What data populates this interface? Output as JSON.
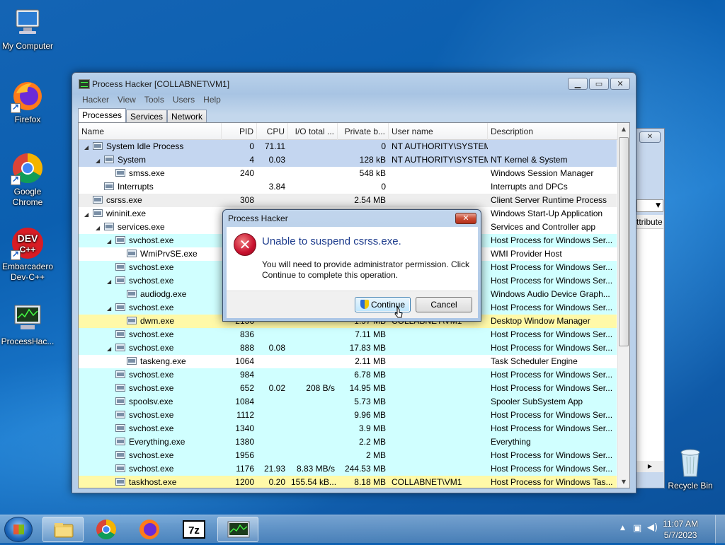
{
  "desktop": {
    "icons": [
      {
        "label": "My Computer"
      },
      {
        "label": "Firefox"
      },
      {
        "label": "Google Chrome"
      },
      {
        "label": "Embarcadero Dev-C++"
      },
      {
        "label": "ProcessHac..."
      },
      {
        "label": "Recycle Bin"
      }
    ]
  },
  "window": {
    "title": "Process Hacker [COLLABNET\\VM1]",
    "menu": [
      "Hacker",
      "View",
      "Tools",
      "Users",
      "Help"
    ],
    "tabs": [
      "Processes",
      "Services",
      "Network"
    ],
    "active_tab": "Processes",
    "columns": [
      "Name",
      "PID",
      "CPU",
      "I/O total ...",
      "Private b...",
      "User name",
      "Description"
    ],
    "rows": [
      {
        "name": "System Idle Process",
        "pid": "0",
        "cpu": "71.11",
        "io": "",
        "priv": "0",
        "user": "NT AUTHORITY\\SYSTEM",
        "desc": "",
        "style": "sys",
        "depth": 0,
        "expand": "◢"
      },
      {
        "name": "System",
        "pid": "4",
        "cpu": "0.03",
        "io": "",
        "priv": "128 kB",
        "user": "NT AUTHORITY\\SYSTEM",
        "desc": "NT Kernel & System",
        "style": "sys",
        "depth": 1,
        "expand": "◢"
      },
      {
        "name": "smss.exe",
        "pid": "240",
        "cpu": "",
        "io": "",
        "priv": "548 kB",
        "user": "",
        "desc": "Windows Session Manager",
        "style": "plain",
        "depth": 2,
        "expand": ""
      },
      {
        "name": "Interrupts",
        "pid": "",
        "cpu": "3.84",
        "io": "",
        "priv": "0",
        "user": "",
        "desc": "Interrupts and DPCs",
        "style": "plain",
        "depth": 1,
        "expand": ""
      },
      {
        "name": "csrss.exe",
        "pid": "308",
        "cpu": "",
        "io": "",
        "priv": "2.54 MB",
        "user": "",
        "desc": "Client Server Runtime Process",
        "style": "gray",
        "depth": 0,
        "expand": ""
      },
      {
        "name": "wininit.exe",
        "pid": "",
        "cpu": "",
        "io": "",
        "priv": "",
        "user": "",
        "desc": "Windows Start-Up Application",
        "style": "plain",
        "depth": 0,
        "expand": "◢"
      },
      {
        "name": "services.exe",
        "pid": "",
        "cpu": "",
        "io": "",
        "priv": "",
        "user": "",
        "desc": "Services and Controller app",
        "style": "plain",
        "depth": 1,
        "expand": "◢"
      },
      {
        "name": "svchost.exe",
        "pid": "",
        "cpu": "",
        "io": "",
        "priv": "",
        "user": "",
        "desc": "Host Process for Windows Ser...",
        "style": "svc",
        "depth": 2,
        "expand": "◢"
      },
      {
        "name": "WmiPrvSE.exe",
        "pid": "",
        "cpu": "",
        "io": "",
        "priv": "",
        "user": "",
        "desc": "WMI Provider Host",
        "style": "plain",
        "depth": 3,
        "expand": ""
      },
      {
        "name": "svchost.exe",
        "pid": "",
        "cpu": "",
        "io": "",
        "priv": "",
        "user": "",
        "desc": "Host Process for Windows Ser...",
        "style": "svc",
        "depth": 2,
        "expand": ""
      },
      {
        "name": "svchost.exe",
        "pid": "",
        "cpu": "",
        "io": "",
        "priv": "",
        "user": "",
        "desc": "Host Process for Windows Ser...",
        "style": "svc",
        "depth": 2,
        "expand": "◢"
      },
      {
        "name": "audiodg.exe",
        "pid": "",
        "cpu": "",
        "io": "",
        "priv": "",
        "user": "",
        "desc": "Windows Audio Device Graph...",
        "style": "svc",
        "depth": 3,
        "expand": ""
      },
      {
        "name": "svchost.exe",
        "pid": "",
        "cpu": "",
        "io": "",
        "priv": "",
        "user": "",
        "desc": "Host Process for Windows Ser...",
        "style": "svc",
        "depth": 2,
        "expand": "◢"
      },
      {
        "name": "dwm.exe",
        "pid": "2156",
        "cpu": "",
        "io": "",
        "priv": "1.97 MB",
        "user": "COLLABNET\\VM1",
        "desc": "Desktop Window Manager",
        "style": "own",
        "depth": 3,
        "expand": ""
      },
      {
        "name": "svchost.exe",
        "pid": "836",
        "cpu": "",
        "io": "",
        "priv": "7.11 MB",
        "user": "",
        "desc": "Host Process for Windows Ser...",
        "style": "svc",
        "depth": 2,
        "expand": ""
      },
      {
        "name": "svchost.exe",
        "pid": "888",
        "cpu": "0.08",
        "io": "",
        "priv": "17.83 MB",
        "user": "",
        "desc": "Host Process for Windows Ser...",
        "style": "svc",
        "depth": 2,
        "expand": "◢"
      },
      {
        "name": "taskeng.exe",
        "pid": "1064",
        "cpu": "",
        "io": "",
        "priv": "2.11 MB",
        "user": "",
        "desc": "Task Scheduler Engine",
        "style": "plain",
        "depth": 3,
        "expand": ""
      },
      {
        "name": "svchost.exe",
        "pid": "984",
        "cpu": "",
        "io": "",
        "priv": "6.78 MB",
        "user": "",
        "desc": "Host Process for Windows Ser...",
        "style": "svc",
        "depth": 2,
        "expand": ""
      },
      {
        "name": "svchost.exe",
        "pid": "652",
        "cpu": "0.02",
        "io": "208 B/s",
        "priv": "14.95 MB",
        "user": "",
        "desc": "Host Process for Windows Ser...",
        "style": "svc",
        "depth": 2,
        "expand": ""
      },
      {
        "name": "spoolsv.exe",
        "pid": "1084",
        "cpu": "",
        "io": "",
        "priv": "5.73 MB",
        "user": "",
        "desc": "Spooler SubSystem App",
        "style": "svc",
        "depth": 2,
        "expand": ""
      },
      {
        "name": "svchost.exe",
        "pid": "1112",
        "cpu": "",
        "io": "",
        "priv": "9.96 MB",
        "user": "",
        "desc": "Host Process for Windows Ser...",
        "style": "svc",
        "depth": 2,
        "expand": ""
      },
      {
        "name": "svchost.exe",
        "pid": "1340",
        "cpu": "",
        "io": "",
        "priv": "3.9 MB",
        "user": "",
        "desc": "Host Process for Windows Ser...",
        "style": "svc",
        "depth": 2,
        "expand": ""
      },
      {
        "name": "Everything.exe",
        "pid": "1380",
        "cpu": "",
        "io": "",
        "priv": "2.2 MB",
        "user": "",
        "desc": "Everything",
        "style": "svc",
        "depth": 2,
        "expand": ""
      },
      {
        "name": "svchost.exe",
        "pid": "1956",
        "cpu": "",
        "io": "",
        "priv": "2 MB",
        "user": "",
        "desc": "Host Process for Windows Ser...",
        "style": "svc",
        "depth": 2,
        "expand": ""
      },
      {
        "name": "svchost.exe",
        "pid": "1176",
        "cpu": "21.93",
        "io": "8.83 MB/s",
        "priv": "244.53 MB",
        "user": "",
        "desc": "Host Process for Windows Ser...",
        "style": "svc",
        "depth": 2,
        "expand": ""
      },
      {
        "name": "taskhost.exe",
        "pid": "1200",
        "cpu": "0.20",
        "io": "155.54 kB...",
        "priv": "8.18 MB",
        "user": "COLLABNET\\VM1",
        "desc": "Host Process for Windows Tas...",
        "style": "own",
        "depth": 2,
        "expand": ""
      }
    ]
  },
  "bg_window": {
    "column_label": "ttribute"
  },
  "dialog": {
    "title": "Process Hacker",
    "close_label": "✕",
    "main_text": "Unable to suspend csrss.exe.",
    "sub_text": "You will need to provide administrator permission. Click Continue to complete this operation.",
    "continue_label": "Continue",
    "cancel_label": "Cancel"
  },
  "taskbar": {
    "time": "11:07 AM",
    "date": "5/7/2023",
    "pinned": [
      "explorer-icon",
      "chrome-icon",
      "firefox-icon",
      "7zip-icon",
      "processhacker-icon"
    ]
  },
  "colors": {
    "system_row": "#c4d6f0",
    "service_row": "#d0ffff",
    "own_row": "#fff9a8",
    "dialog_heading": "#1c3b8c"
  }
}
